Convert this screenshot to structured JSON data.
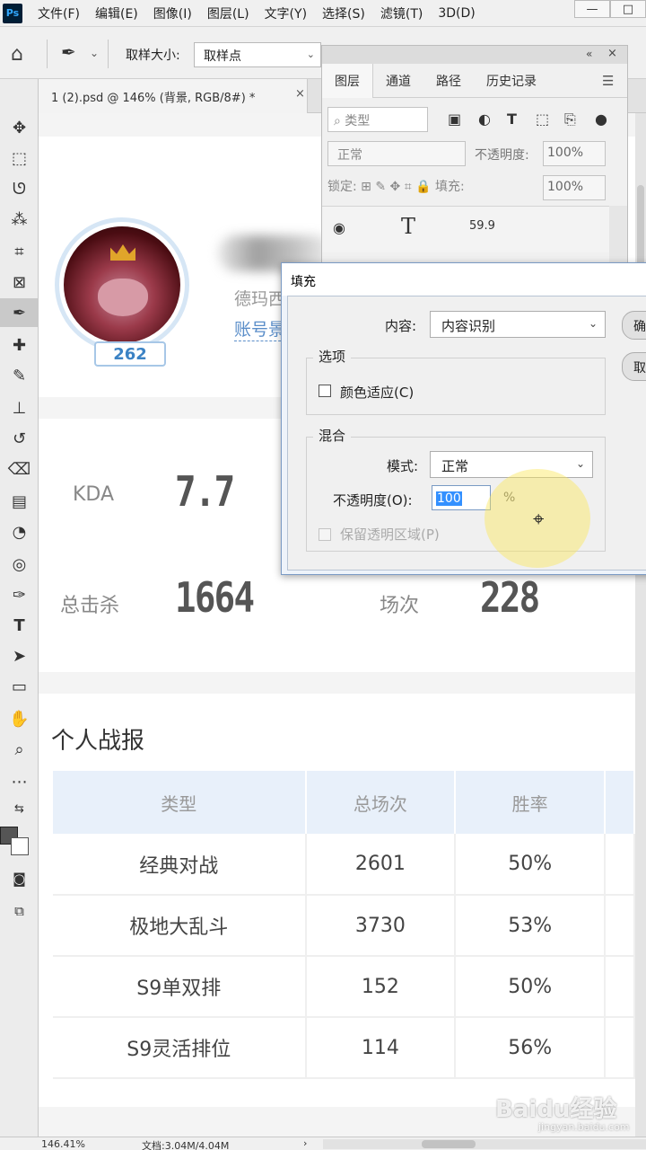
{
  "menubar": {
    "logo": "Ps",
    "items": [
      "文件(F)",
      "编辑(E)",
      "图像(I)",
      "图层(L)",
      "文字(Y)",
      "选择(S)",
      "滤镜(T)",
      "3D(D)"
    ],
    "window_controls": [
      "—",
      "□"
    ]
  },
  "options": {
    "sample_size_label": "取样大小:",
    "sample_size_value": "取样点"
  },
  "document": {
    "tab_title": "1 (2).psd @ 146% (背景, RGB/8#) *",
    "tab_close": "×"
  },
  "profile": {
    "level": "262",
    "server_text": "德玛西",
    "account_text": "账号景"
  },
  "stats": {
    "kda_label": "KDA",
    "kda_value": "7.7",
    "kills_label": "总击杀",
    "kills_value": "1664",
    "games_label": "场次",
    "games_value": "228"
  },
  "report": {
    "title": "个人战报",
    "columns": [
      "类型",
      "总场次",
      "胜率"
    ],
    "rows": [
      [
        "经典对战",
        "2601",
        "50%"
      ],
      [
        "极地大乱斗",
        "3730",
        "53%"
      ],
      [
        "S9单双排",
        "152",
        "50%"
      ],
      [
        "S9灵活排位",
        "114",
        "56%"
      ]
    ]
  },
  "layers_panel": {
    "collapse": "«",
    "close": "×",
    "tabs": [
      "图层",
      "通道",
      "路径",
      "历史记录"
    ],
    "filter_placeholder": "类型",
    "blend_mode": "正常",
    "opacity_label": "不透明度:",
    "opacity_value": "100%",
    "lock_label": "锁定:",
    "fill_label": "填充:",
    "fill_value": "100%",
    "layer_name": "59.9"
  },
  "fill_dialog": {
    "title": "填充",
    "content_label": "内容:",
    "content_value": "内容识别",
    "options_legend": "选项",
    "color_adapt_label": "颜色适应(C)",
    "blend_legend": "混合",
    "mode_label": "模式:",
    "mode_value": "正常",
    "opacity_label": "不透明度(O):",
    "opacity_value": "100",
    "opacity_unit": "%",
    "preserve_label": "保留透明区域(P)",
    "ok_button": "确",
    "cancel_button": "取"
  },
  "status": {
    "zoom": "146.41%",
    "doc_size": "文档:3.04M/4.04M",
    "arrow": "›"
  },
  "watermark": {
    "main": "Baidu经验",
    "sub": "jingyan.baidu.com"
  }
}
